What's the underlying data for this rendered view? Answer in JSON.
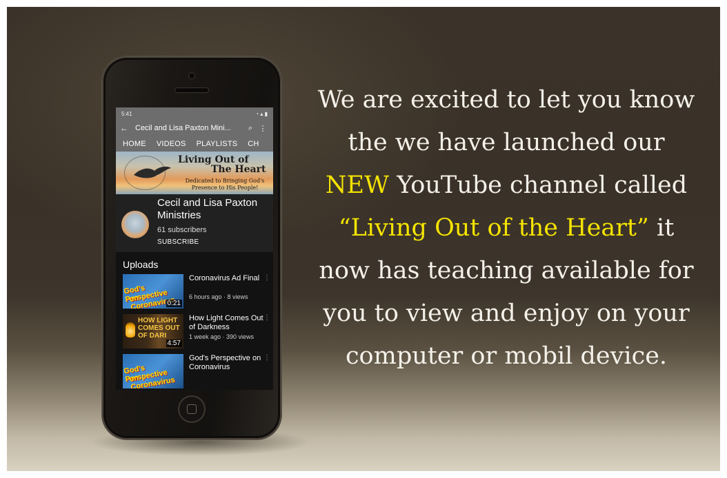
{
  "colors": {
    "highlight": "#f5e400",
    "text": "#f4f1ea"
  },
  "phone": {
    "status": {
      "time": "5:41",
      "left_icon": "cloud-icon",
      "right_icons": "wifi-signal-battery-icons"
    },
    "appbar": {
      "back_icon": "←",
      "title": "Cecil and Lisa Paxton Mini...",
      "search_icon": "🔍",
      "more_icon": "⋮"
    },
    "tabs": [
      "HOME",
      "VIDEOS",
      "PLAYLISTS",
      "CH"
    ],
    "banner": {
      "seal_text": "Cecil & Lisa Paxton Ministries",
      "title_line1": "Living Out of",
      "title_line2": "The Heart",
      "subtitle_line1": "Dedicated to Bringing God's",
      "subtitle_line2": "Presence to His People!"
    },
    "channel": {
      "name": "Cecil and Lisa Paxton Ministries",
      "subscribers": "61 subscribers",
      "subscribe_label": "SUBSCRIBE"
    },
    "uploads_label": "Uploads",
    "videos": [
      {
        "title": "Coronavirus Ad Final",
        "meta": "6 hours ago · 8 views",
        "duration": "0:21",
        "thumb_line1": "God's Perspective",
        "thumb_line2": "on Coronavirus"
      },
      {
        "title": "How Light Comes Out of Darkness",
        "meta": "1 week ago · 390 views",
        "duration": "4:57",
        "thumb_line1": "HOW LIGHT",
        "thumb_line2": "COMES OUT",
        "thumb_line3": "OF DARI"
      },
      {
        "title": "God's Perspective on Coronavirus",
        "meta": "",
        "duration": "",
        "thumb_line1": "God's Perspective",
        "thumb_line2": "on Coronavirus"
      }
    ]
  },
  "headline": {
    "part1": "We are excited to let you know the we have launched our ",
    "new_word": "NEW",
    "part2": " YouTube channel called ",
    "channel_quote": "“Living Out of the Heart”",
    "part3": " it now has teaching available for you to view and enjoy on your computer or mobil device."
  }
}
